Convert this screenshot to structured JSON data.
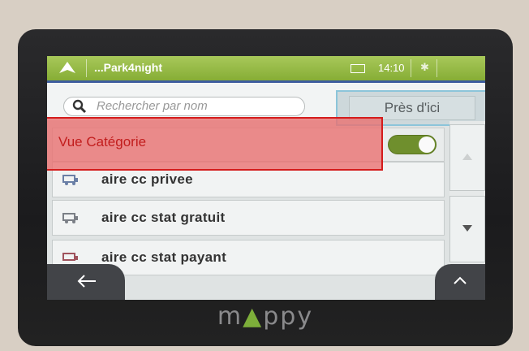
{
  "statusbar": {
    "title": "...Park4night",
    "time": "14:10"
  },
  "search": {
    "placeholder": "Rechercher par nom"
  },
  "nearby_button": "Près d'ici",
  "category_view": {
    "label": "Vue Catégorie",
    "toggle_on": true
  },
  "list": {
    "items": [
      {
        "label": "aire cc privee",
        "icon": "camper-icon"
      },
      {
        "label": "aire cc stat gratuit",
        "icon": "camper-icon"
      },
      {
        "label": "aire cc stat payant",
        "icon": "camper-icon"
      }
    ]
  },
  "brand": {
    "name": "mappy"
  },
  "colors": {
    "header_green": "#94b846",
    "toggle_green": "#6f8f2d",
    "highlight_red": "#d41c1c",
    "highlight_blue": "#8cc5da",
    "device_body": "#1f1f21"
  }
}
